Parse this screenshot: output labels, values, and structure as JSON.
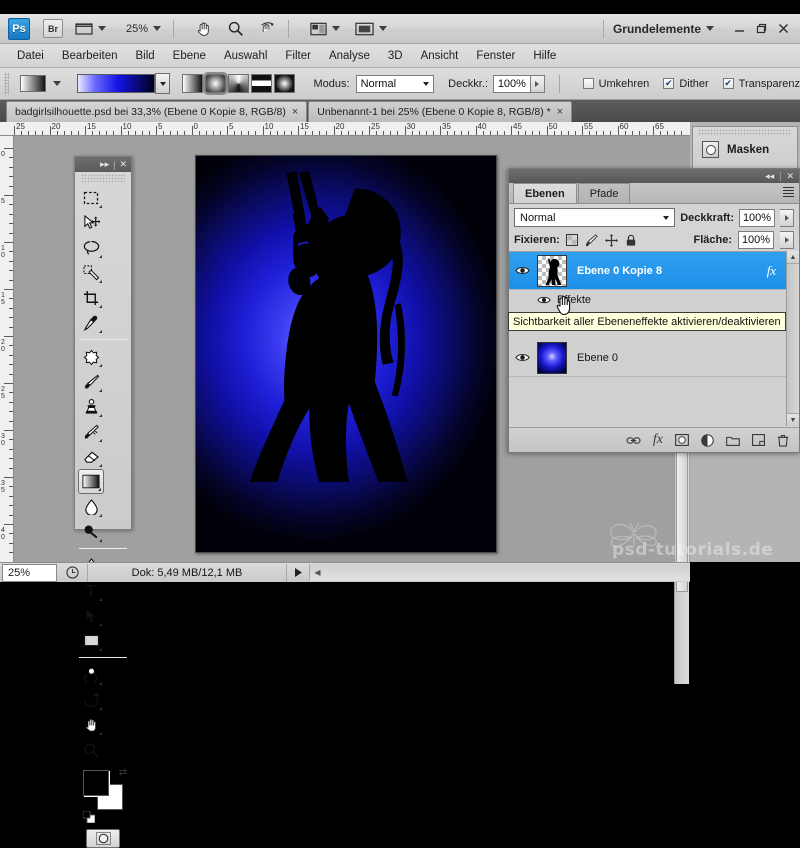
{
  "app": {
    "logo_text": "Ps",
    "bridge_label": "Br",
    "zoom_level": "25%",
    "workspace_label": "Grundelemente",
    "window_buttons": [
      "minimize-icon",
      "restore-icon",
      "close-icon"
    ],
    "toolbar_icons": [
      "view-extras-icon",
      "hand-tool-icon",
      "zoom-tool-icon",
      "rotate-view-icon",
      "screen-mode-icon",
      "arrange-documents-icon"
    ]
  },
  "menubar": {
    "items": [
      "Datei",
      "Bearbeiten",
      "Bild",
      "Ebene",
      "Auswahl",
      "Filter",
      "Analyse",
      "3D",
      "Ansicht",
      "Fenster",
      "Hilfe"
    ]
  },
  "options_bar": {
    "gradient_preset_name": "gradient-preset-swatch",
    "gradient_types": [
      "linear-gradient-icon",
      "radial-gradient-icon",
      "angle-gradient-icon",
      "reflected-gradient-icon",
      "diamond-gradient-icon"
    ],
    "selected_gradient_type_index": 1,
    "mode_label": "Modus:",
    "mode_value": "Normal",
    "opacity_label": "Deckkr.:",
    "opacity_value": "100%",
    "checkboxes": [
      {
        "label": "Umkehren",
        "checked": false
      },
      {
        "label": "Dither",
        "checked": true
      },
      {
        "label": "Transparenz",
        "checked": true
      }
    ]
  },
  "tabs": [
    {
      "title": "badgirlsilhouette.psd bei 33,3% (Ebene 0 Kopie 8, RGB/8)",
      "active": true,
      "close": "×"
    },
    {
      "title": "Unbenannt-1 bei 25% (Ebene 0 Kopie 8, RGB/8) *",
      "active": false,
      "close": "×"
    }
  ],
  "rulers": {
    "h_labels": [
      "25",
      "20",
      "15",
      "10",
      "5",
      "0",
      "5",
      "10",
      "15",
      "20",
      "25",
      "30",
      "35",
      "40",
      "45",
      "50",
      "55",
      "60",
      "65"
    ],
    "v_labels": [
      "0",
      "5",
      "10",
      "15",
      "20",
      "25",
      "30",
      "35",
      "40"
    ],
    "unit": "cm"
  },
  "tools": {
    "panel_title_icons": [
      "collapse-icon",
      "close-icon"
    ],
    "items": [
      "rectangular-marquee-tool",
      "move-tool",
      "lasso-tool",
      "quick-selection-tool",
      "crop-tool",
      "eyedropper-tool",
      "spot-healing-brush-tool",
      "brush-tool",
      "clone-stamp-tool",
      "history-brush-tool",
      "eraser-tool",
      "gradient-tool",
      "blur-tool",
      "dodge-tool",
      "pen-tool",
      "type-tool",
      "path-selection-tool",
      "rectangle-shape-tool",
      "3d-rotate-tool",
      "3d-orbit-tool",
      "hand-tool",
      "zoom-tool"
    ],
    "selected_tool": "gradient-tool",
    "foreground_color": "#000000",
    "background_color": "#ffffff",
    "quick_mask_label": "quick-mask-button"
  },
  "masks_panel": {
    "title": "Masken",
    "icon": "mask-thumbnail-icon",
    "buttons": [
      "collapse-icon",
      "close-icon"
    ]
  },
  "layers_panel": {
    "tabs": [
      {
        "label": "Ebenen",
        "active": true
      },
      {
        "label": "Pfade",
        "active": false
      }
    ],
    "menu_icon": "panel-menu-icon",
    "titlebar_icons": [
      "collapse-icon",
      "close-icon"
    ],
    "blend_mode": "Normal",
    "opacity_label": "Deckkraft:",
    "opacity_value": "100%",
    "lock_label": "Fixieren:",
    "lock_icons": [
      "lock-transparency-icon",
      "lock-image-icon",
      "lock-position-icon",
      "lock-all-icon"
    ],
    "fill_label": "Fläche:",
    "fill_value": "100%",
    "layers": [
      {
        "name": "Ebene 0 Kopie 8",
        "selected": true,
        "visible": true,
        "has_effects": true,
        "fx_badge": "fx",
        "thumb_type": "silhouette-thumbnail",
        "sublabel": "Effekte"
      },
      {
        "name": "Ebene 0",
        "selected": false,
        "visible": true,
        "has_effects": false,
        "thumb_type": "glow-thumbnail"
      }
    ],
    "bottom_icons": [
      "link-layers-icon",
      "add-layer-style-icon",
      "add-layer-mask-icon",
      "new-fill-adjustment-layer-icon",
      "new-group-icon",
      "new-layer-icon",
      "delete-layer-icon"
    ]
  },
  "tooltip": {
    "text": "Sichtbarkeit aller Ebeneneffekte aktivieren/deaktivieren"
  },
  "status_bar": {
    "zoom_value": "25%",
    "doc_info": "Dok: 5,49 MB/12,1 MB",
    "preview_icon": "document-preview-icon",
    "expand_icon": "status-expand-icon"
  },
  "watermark": {
    "text": "psd-tutorials.de"
  },
  "colors": {
    "accent_blue": "#1e90e8",
    "tooltip_bg": "#ffffdc",
    "panel_gray": "#d4d4d4",
    "canvas_gray": "#a0a0a0",
    "image_blue": "#1f1fd8"
  }
}
